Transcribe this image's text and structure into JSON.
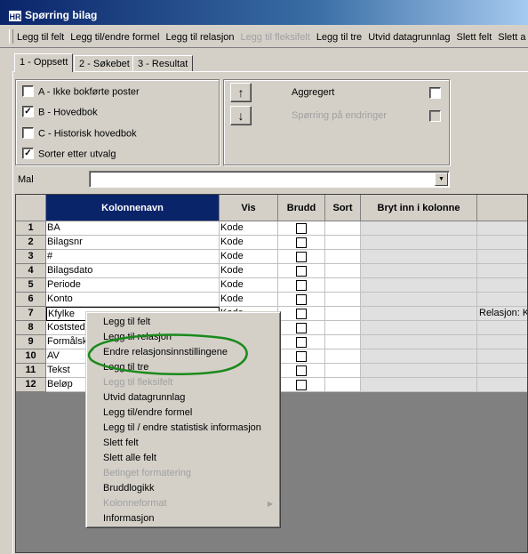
{
  "window": {
    "icon_text": "HR",
    "title": "Spørring bilag"
  },
  "toolbar": {
    "items": [
      {
        "label": "Legg til felt",
        "disabled": false
      },
      {
        "label": "Legg til/endre formel",
        "disabled": false
      },
      {
        "label": "Legg til relasjon",
        "disabled": false
      },
      {
        "label": "Legg til fleksifelt",
        "disabled": true
      },
      {
        "label": "Legg til tre",
        "disabled": false
      },
      {
        "label": "Utvid datagrunnlag",
        "disabled": false
      },
      {
        "label": "Slett felt",
        "disabled": false
      },
      {
        "label": "Slett a",
        "disabled": false
      }
    ]
  },
  "tabs": [
    {
      "label": "1 - Oppsett",
      "active": true
    },
    {
      "label": "2 - Søkebet",
      "active": false
    },
    {
      "label": "3 - Resultat",
      "active": false
    }
  ],
  "options": {
    "items": [
      {
        "label": "A - Ikke bokførte poster",
        "checked": false
      },
      {
        "label": "B - Hovedbok",
        "checked": true
      },
      {
        "label": "C - Historisk hovedbok",
        "checked": false
      },
      {
        "label": "Sorter etter utvalg",
        "checked": true
      }
    ]
  },
  "controls": {
    "up_icon": "up-arrow-icon",
    "down_icon": "down-arrow-icon",
    "up_glyph": "↑",
    "down_glyph": "↓",
    "aggregert_label": "Aggregert",
    "aggregert_checked": false,
    "sporring_label": "Spørring på endringer",
    "sporring_checked": false,
    "sporring_disabled": true
  },
  "mal": {
    "label": "Mal",
    "value": ""
  },
  "grid": {
    "headers": {
      "name": "Kolonnenavn",
      "vis": "Vis",
      "brudd": "Brudd",
      "sort": "Sort",
      "bryt": "Bryt inn i kolonne"
    },
    "rows": [
      {
        "num": "1",
        "name": "BA",
        "vis": "Kode",
        "extra": ""
      },
      {
        "num": "2",
        "name": "Bilagsnr",
        "vis": "Kode",
        "extra": ""
      },
      {
        "num": "3",
        "name": "#",
        "vis": "Kode",
        "extra": ""
      },
      {
        "num": "4",
        "name": "Bilagsdato",
        "vis": "Kode",
        "extra": ""
      },
      {
        "num": "5",
        "name": "Periode",
        "vis": "Kode",
        "extra": ""
      },
      {
        "num": "6",
        "name": "Konto",
        "vis": "Kode",
        "extra": ""
      },
      {
        "num": "7",
        "name": "Kfylke",
        "vis": "Kode",
        "extra": "Relasjon: K"
      },
      {
        "num": "8",
        "name": "Koststed",
        "vis": "",
        "extra": ""
      },
      {
        "num": "9",
        "name": "Formålsko",
        "vis": "",
        "extra": ""
      },
      {
        "num": "10",
        "name": "AV",
        "vis": "",
        "extra": ""
      },
      {
        "num": "11",
        "name": "Tekst",
        "vis": "",
        "extra": ""
      },
      {
        "num": "12",
        "name": "Beløp",
        "vis": "",
        "extra": ""
      }
    ]
  },
  "context_menu": {
    "items": [
      {
        "label": "Legg til felt",
        "disabled": false
      },
      {
        "label": "Legg til relasjon",
        "disabled": false
      },
      {
        "label": "Endre relasjonsinnstillingene",
        "disabled": false,
        "highlighted_by_annotation": true
      },
      {
        "label": "Legg til tre",
        "disabled": false
      },
      {
        "label": "Legg til fleksifelt",
        "disabled": true
      },
      {
        "label": "Utvid datagrunnlag",
        "disabled": false
      },
      {
        "label": "Legg til/endre formel",
        "disabled": false
      },
      {
        "label": "Legg til / endre statistisk informasjon",
        "disabled": false
      },
      {
        "label": "Slett felt",
        "disabled": false
      },
      {
        "label": "Slett alle felt",
        "disabled": false
      },
      {
        "label": "Betinget formatering",
        "disabled": true
      },
      {
        "label": "Bruddlogikk",
        "disabled": false
      },
      {
        "label": "Kolonneformat",
        "disabled": true,
        "has_submenu": true
      },
      {
        "label": "Informasjon",
        "disabled": false
      }
    ]
  },
  "annotation": {
    "color": "#1a8a1a",
    "shape": "hand-drawn-ellipse"
  }
}
